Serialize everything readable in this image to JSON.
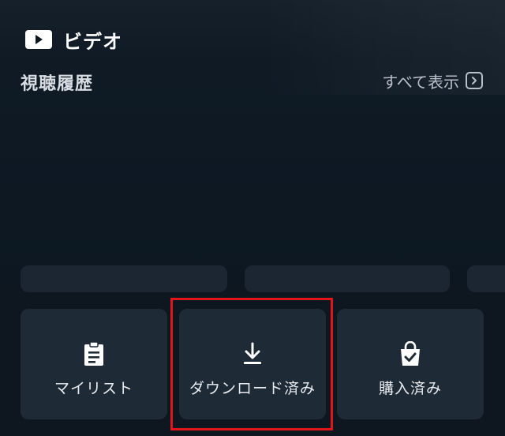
{
  "header": {
    "title": "ビデオ",
    "icon": "play-icon"
  },
  "history": {
    "title": "視聴履歴",
    "see_all_label": "すべて表示",
    "see_all_icon": "chevron-right-icon"
  },
  "tiles": [
    {
      "label": "マイリスト",
      "icon": "clipboard-list-icon"
    },
    {
      "label": "ダウンロード済み",
      "icon": "download-icon"
    },
    {
      "label": "購入済み",
      "icon": "shopping-bag-check-icon"
    }
  ],
  "colors": {
    "background": "#0e1620",
    "tile": "#1f2a37",
    "highlight": "#e0161b",
    "text": "#ffffff",
    "muted_text": "#b8c0c9"
  }
}
